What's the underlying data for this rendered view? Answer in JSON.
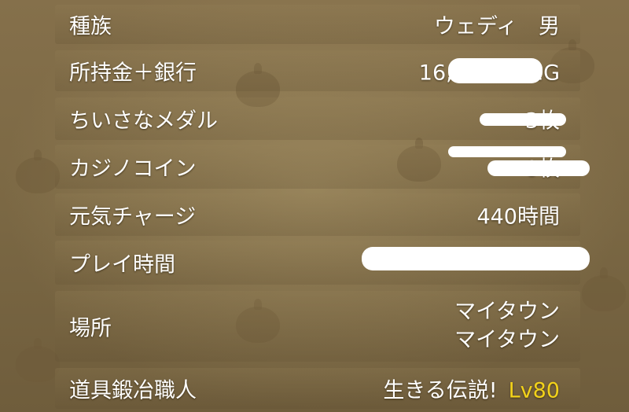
{
  "colors": {
    "text": "#ffffff",
    "level": "#f2d21a",
    "panel": "#7b6844"
  },
  "rows": [
    {
      "label": "種族",
      "value": "ウェディ　男"
    },
    {
      "label": "所持金＋銀行",
      "value": "16,　　　71G"
    },
    {
      "label": "ちいさなメダル",
      "value": "3枚"
    },
    {
      "label": "カジノコイン",
      "value": "0枚"
    },
    {
      "label": "元気チャージ",
      "value": "440時間"
    },
    {
      "label": "プレイ時間",
      "value": ""
    },
    {
      "label": "場所",
      "value_line1": "マイタウン",
      "value_line2": "マイタウン"
    },
    {
      "label": "道具鍛冶職人",
      "value": "生きる伝説!",
      "level": "Lv80"
    }
  ]
}
